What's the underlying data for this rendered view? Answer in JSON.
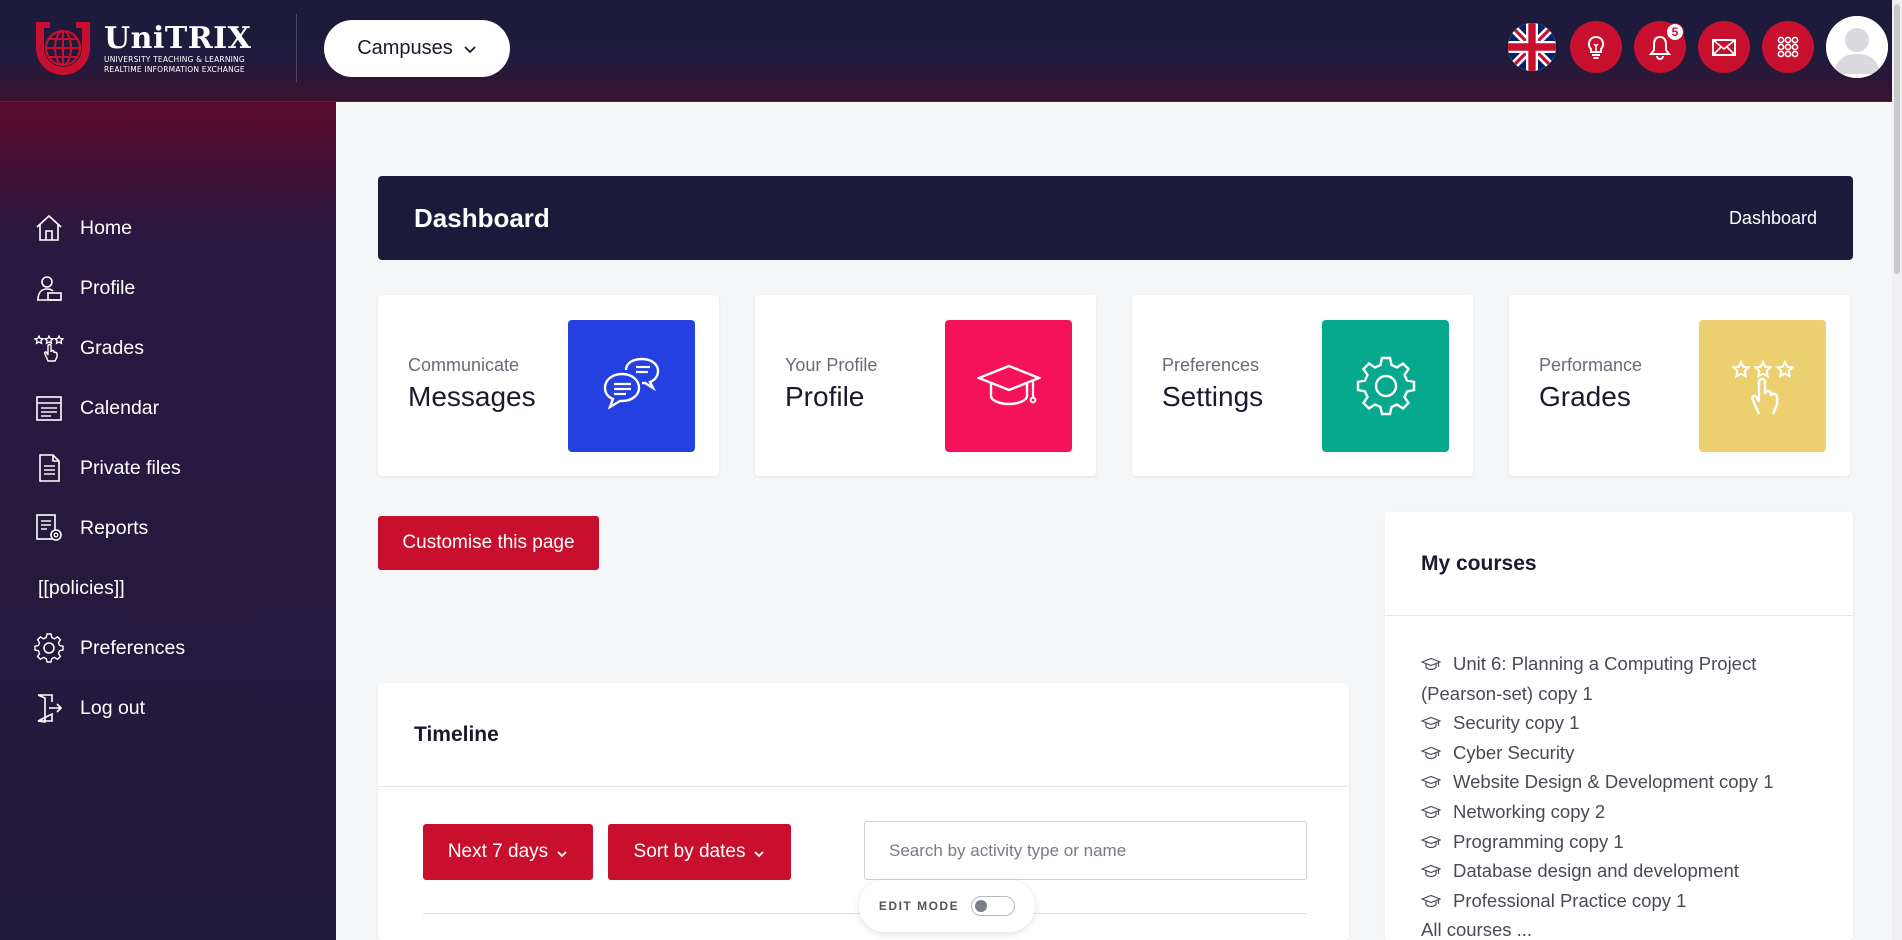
{
  "header": {
    "logo_title": "UniTRIX",
    "logo_subtitle_line1": "UNIVERSITY TEACHING & LEARNING",
    "logo_subtitle_line2": "REALTIME INFORMATION EXCHANGE",
    "campuses_label": "Campuses",
    "notification_count": "5",
    "icons": [
      "uk-flag-icon",
      "lightbulb-icon",
      "bell-icon",
      "mail-icon",
      "app-grid-icon",
      "user-avatar"
    ]
  },
  "sidebar": {
    "items": [
      {
        "label": "Home",
        "icon": "home-icon"
      },
      {
        "label": "Profile",
        "icon": "profile-icon"
      },
      {
        "label": "Grades",
        "icon": "grades-icon"
      },
      {
        "label": "Calendar",
        "icon": "calendar-icon"
      },
      {
        "label": "Private files",
        "icon": "file-icon"
      },
      {
        "label": "Reports",
        "icon": "reports-icon"
      },
      {
        "label": "[[policies]]",
        "icon": ""
      },
      {
        "label": "Preferences",
        "icon": "gear-icon"
      },
      {
        "label": "Log out",
        "icon": "logout-icon"
      }
    ]
  },
  "page": {
    "title": "Dashboard",
    "breadcrumb": "Dashboard"
  },
  "cards": [
    {
      "subtitle": "Communicate",
      "title": "Messages",
      "color": "#2440e0",
      "icon": "chat-bubbles-icon"
    },
    {
      "subtitle": "Your Profile",
      "title": "Profile",
      "color": "#f41358",
      "icon": "graduation-cap-icon"
    },
    {
      "subtitle": "Preferences",
      "title": "Settings",
      "color": "#06a88e",
      "icon": "gear-icon"
    },
    {
      "subtitle": "Performance",
      "title": "Grades",
      "color": "#ecd06f",
      "icon": "stars-hand-icon"
    }
  ],
  "customise_label": "Customise this page",
  "timeline": {
    "title": "Timeline",
    "range_label": "Next 7 days",
    "sort_label": "Sort by dates",
    "search_placeholder": "Search by activity type or name"
  },
  "edit_mode": {
    "label": "EDIT MODE",
    "enabled": false
  },
  "my_courses": {
    "title": "My courses",
    "courses": [
      "Unit 6: Planning a Computing Project (Pearson-set) copy 1",
      "Security copy 1",
      "Cyber Security",
      "Website Design & Development copy 1",
      "Networking copy 2",
      "Programming copy 1",
      "Database design and development",
      "Professional Practice copy 1"
    ],
    "all_courses_label": "All courses ..."
  },
  "colors": {
    "accent": "#c8102e",
    "navy": "#1c1a3a"
  }
}
